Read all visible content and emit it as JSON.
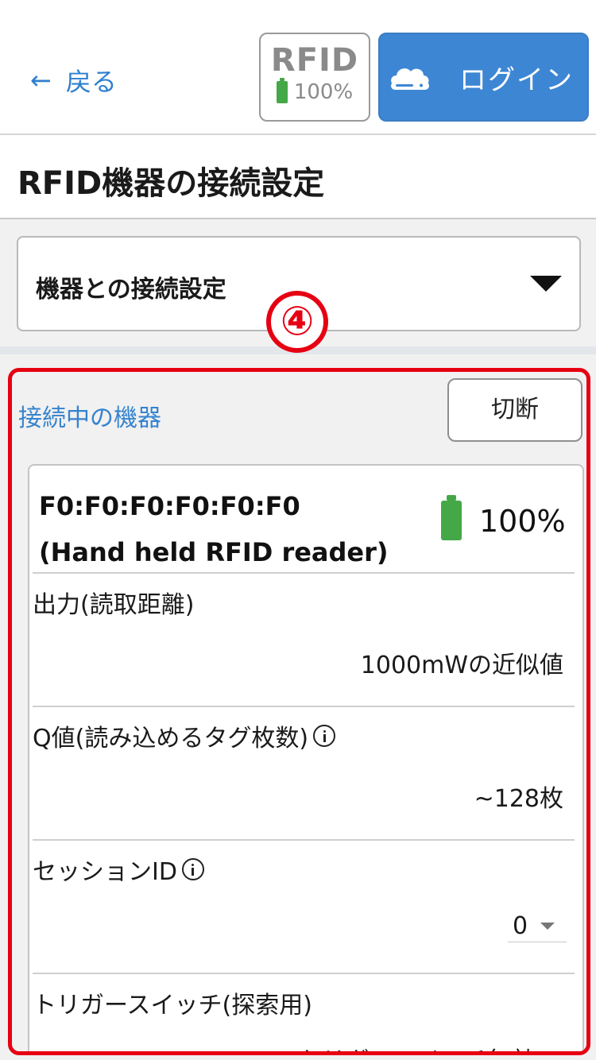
{
  "header": {
    "back_label": "戻る",
    "rfid_badge": {
      "title": "RFID",
      "battery": "100%"
    },
    "login_label": "ログイン"
  },
  "page": {
    "title": "RFID機器の接続設定"
  },
  "connection_select": {
    "selected": "機器との接続設定"
  },
  "annotation": {
    "marker": "④",
    "color": "#e60012"
  },
  "connected_section": {
    "label": "接続中の機器",
    "disconnect_label": "切断",
    "device": {
      "address": "F0:F0:F0:F0:F0:F0",
      "model": "(Hand held RFID reader)",
      "battery": "100%"
    },
    "settings": [
      {
        "label": "出力(読取距離)",
        "value": "1000mWの近似値",
        "info": false
      },
      {
        "label": "Q値(読み込めるタグ枚数)",
        "value": "~128枚",
        "info": true
      },
      {
        "label": "セッションID",
        "value": "0",
        "info": true,
        "dropdown": true
      },
      {
        "label": "トリガースイッチ(探索用)",
        "value": "トリガースイッチ無効",
        "info": false,
        "dropdown": true
      }
    ]
  },
  "colors": {
    "accent": "#3d86d4",
    "link": "#2f7fcf",
    "battery": "#45a847",
    "highlight": "#e60012"
  }
}
